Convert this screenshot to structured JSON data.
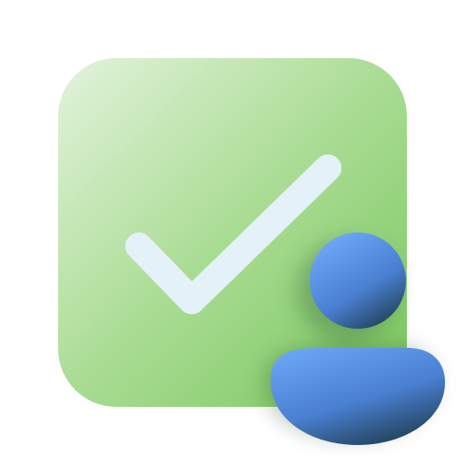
{
  "icon": {
    "name": "user-approved-icon",
    "parts": [
      "checkmark-tile-icon",
      "user-avatar-icon"
    ],
    "colors": {
      "tile_light": "#e3f3dc",
      "tile_mid": "#a9dc93",
      "tile_dark": "#79c65c",
      "check": "#e4f1f9",
      "user_light": "#6aa4f5",
      "user_mid": "#4a7fd0",
      "user_dark": "#1f3f54",
      "background": "#ffffff"
    }
  }
}
